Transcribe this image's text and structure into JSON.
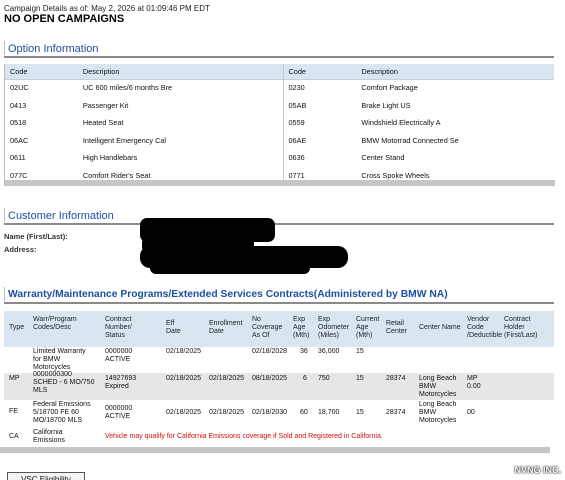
{
  "campaign": {
    "asof_text": "Campaign Details as of: May 2, 2026 at 01:09:46 PM EDT",
    "status": "NO OPEN CAMPAIGNS"
  },
  "option_info": {
    "title": "Option Information",
    "headers": [
      "Code",
      "Description",
      "Code",
      "Description"
    ],
    "rows": [
      [
        "02UC",
        "UC 600 miles/6 months Bre",
        "0230",
        "Comfort Package"
      ],
      [
        "0413",
        "Passenger Kit",
        "05AB",
        "Brake Light US"
      ],
      [
        "0518",
        "Heated Seat",
        "0559",
        "Windshield Electrically A"
      ],
      [
        "06AC",
        "Intelligent Emergency Cal",
        "06AE",
        "BMW Motorrad Connected Se"
      ],
      [
        "0611",
        "High Handlebars",
        "0636",
        "Center Stand"
      ],
      [
        "077C",
        "Comfort Rider's Seat",
        "0771",
        "Cross Spoke Wheels"
      ]
    ]
  },
  "customer_info": {
    "title": "Customer Information",
    "name_label": "Name (First/Last):",
    "address_label": "Address:"
  },
  "warranty": {
    "title": "Warranty/Maintenance Programs/Extended Services Contracts(Administered by BMW NA)",
    "headers": {
      "type": "Type",
      "program": [
        "Warr/Program",
        "Codes/Desc"
      ],
      "contract": [
        "Contract",
        "Number/",
        "Status"
      ],
      "eff": [
        "Eff",
        "Date"
      ],
      "enroll": [
        "Enrollment",
        "Date"
      ],
      "coverage": [
        "No",
        "Coverage",
        "As Of"
      ],
      "exp_age": [
        "Exp",
        "Age",
        "(Mth)"
      ],
      "exp_odo": [
        "Exp",
        "Odometer",
        "(Miles)"
      ],
      "cur_age": [
        "Current",
        "Age",
        "(Mth)"
      ],
      "retail": [
        "Retail",
        "Center"
      ],
      "center_name": "Center Name",
      "vendor": [
        "Vendor",
        "Code",
        "/Deductible"
      ],
      "holder": [
        "Contract",
        "Holder",
        "(First/Last)"
      ]
    },
    "rows": [
      {
        "type": "",
        "program": [
          "Limited Warranty",
          "for BMW",
          "Motorcycles"
        ],
        "contract": [
          "0000000",
          "ACTIVE"
        ],
        "eff": "02/18/2025",
        "enroll": "",
        "coverage": "02/18/2028",
        "exp_age": "36",
        "exp_odo": "36,000",
        "cur_age": "15",
        "retail": "",
        "center": [],
        "vendor": []
      },
      {
        "type": "MP",
        "program": [
          "0000000300",
          "SCHED - 6 MO/750",
          "MLS"
        ],
        "contract": [
          "14927693",
          "Expired"
        ],
        "eff": "02/18/2025",
        "enroll": "02/18/2025",
        "coverage": "08/18/2025",
        "exp_age": "6",
        "exp_odo": "750",
        "cur_age": "15",
        "retail": "28374",
        "center": [
          "Long Beach",
          "BMW",
          "Motorcycles"
        ],
        "vendor": [
          "MP",
          "0.00"
        ]
      },
      {
        "type": "FE",
        "program": [
          "Federal Emissions",
          "5/18700 FE 60",
          "MO/18700 MLS"
        ],
        "contract": [
          "0000000",
          "ACTIVE"
        ],
        "eff": "02/18/2025",
        "enroll": "02/18/2025",
        "coverage": "02/18/2030",
        "exp_age": "60",
        "exp_odo": "18,700",
        "cur_age": "15",
        "retail": "28374",
        "center": [
          "Long Beach",
          "BMW",
          "Motorcycles"
        ],
        "vendor": [
          "00"
        ]
      },
      {
        "type": "CA",
        "program": [
          "California",
          "Emissions"
        ],
        "note": "Vehicle may qualify for California Emissions coverage if Sold and Registered in California."
      }
    ]
  },
  "buttons": {
    "vsc": "VSC Eligibility"
  },
  "watermark": "NVNG INC."
}
